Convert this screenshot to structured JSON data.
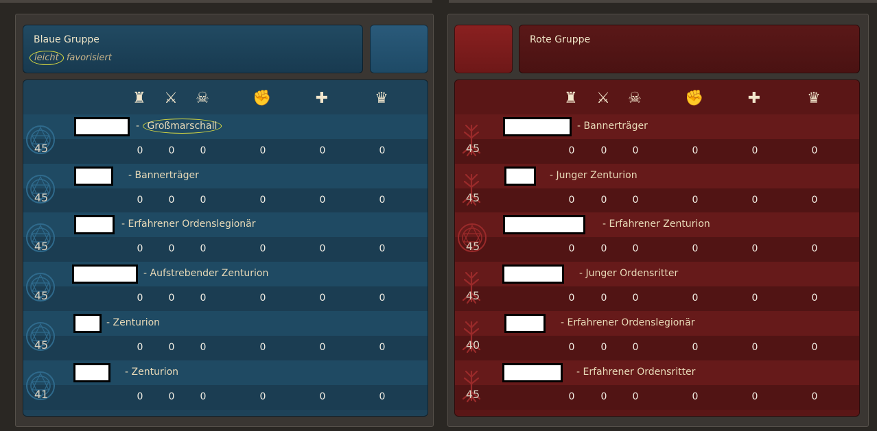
{
  "blue": {
    "title": "Blaue Gruppe",
    "sub_word1": "leicht",
    "sub_word2": "favorisiert",
    "color": "#1e4258",
    "rows": [
      {
        "level": "45",
        "rank": "- Großmarschall",
        "stats": [
          "0",
          "0",
          "0",
          "0",
          "0",
          "0"
        ]
      },
      {
        "level": "45",
        "rank": "- Bannerträger",
        "stats": [
          "0",
          "0",
          "0",
          "0",
          "0",
          "0"
        ]
      },
      {
        "level": "45",
        "rank": "- Erfahrener Ordenslegionär",
        "stats": [
          "0",
          "0",
          "0",
          "0",
          "0",
          "0"
        ]
      },
      {
        "level": "45",
        "rank": "- Aufstrebender Zenturion",
        "stats": [
          "0",
          "0",
          "0",
          "0",
          "0",
          "0"
        ]
      },
      {
        "level": "45",
        "rank": "- Zenturion",
        "stats": [
          "0",
          "0",
          "0",
          "0",
          "0",
          "0"
        ]
      },
      {
        "level": "41",
        "rank": "- Zenturion",
        "stats": [
          "0",
          "0",
          "0",
          "0",
          "0",
          "0"
        ]
      }
    ]
  },
  "red": {
    "title": "Rote Gruppe",
    "color": "#5a1616",
    "rows": [
      {
        "level": "45",
        "rank": "- Bannerträger",
        "stats": [
          "0",
          "0",
          "0",
          "0",
          "0",
          "0"
        ]
      },
      {
        "level": "45",
        "rank": "- Junger Zenturion",
        "stats": [
          "0",
          "0",
          "0",
          "0",
          "0",
          "0"
        ]
      },
      {
        "level": "45",
        "rank": "- Erfahrener Zenturion",
        "stats": [
          "0",
          "0",
          "0",
          "0",
          "0",
          "0"
        ]
      },
      {
        "level": "45",
        "rank": "- Junger Ordensritter",
        "stats": [
          "0",
          "0",
          "0",
          "0",
          "0",
          "0"
        ]
      },
      {
        "level": "40",
        "rank": "- Erfahrener Ordenslegionär",
        "stats": [
          "0",
          "0",
          "0",
          "0",
          "0",
          "0"
        ]
      },
      {
        "level": "45",
        "rank": "- Erfahrener Ordensritter",
        "stats": [
          "0",
          "0",
          "0",
          "0",
          "0",
          "0"
        ]
      }
    ]
  },
  "columns": {
    "icons": [
      "tower-icon",
      "crossed-swords-icon",
      "skull-icon",
      "fist-icon",
      "plus-icon",
      "crown-icon"
    ],
    "glyphs": [
      "♜",
      "⚔",
      "☠",
      "✊",
      "✚",
      "♛"
    ]
  }
}
